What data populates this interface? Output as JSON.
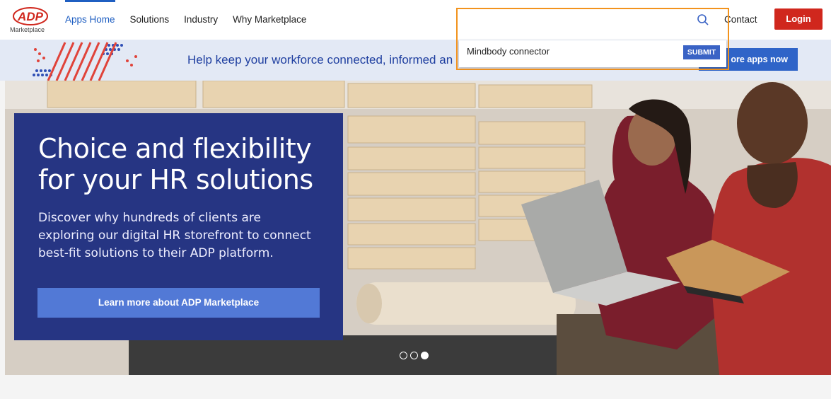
{
  "header": {
    "logo_text": "ADP",
    "logo_sub": "Marketplace",
    "nav": [
      {
        "label": "Apps Home",
        "active": true
      },
      {
        "label": "Solutions",
        "active": false
      },
      {
        "label": "Industry",
        "active": false
      },
      {
        "label": "Why Marketplace",
        "active": false
      }
    ],
    "contact": "Contact",
    "login": "Login"
  },
  "search": {
    "query": "",
    "suggestion": "Mindbody connector",
    "submit_label": "SUBMIT"
  },
  "banner": {
    "message": "Help keep your workforce connected, informed an",
    "cta": "ore apps now"
  },
  "hero": {
    "title_line1": "Choice and flexibility",
    "title_line2": "for your HR solutions",
    "body": "Discover why hundreds of clients are exploring our digital HR storefront to connect best-fit solutions to their ADP platform.",
    "button": "Learn more about ADP Marketplace",
    "carousel": {
      "slides": 3,
      "active": 3
    }
  },
  "colors": {
    "brand_red": "#d0271d",
    "nav_active": "#1f5fc2",
    "panel": "#263583",
    "search_outline": "#f2931d"
  }
}
